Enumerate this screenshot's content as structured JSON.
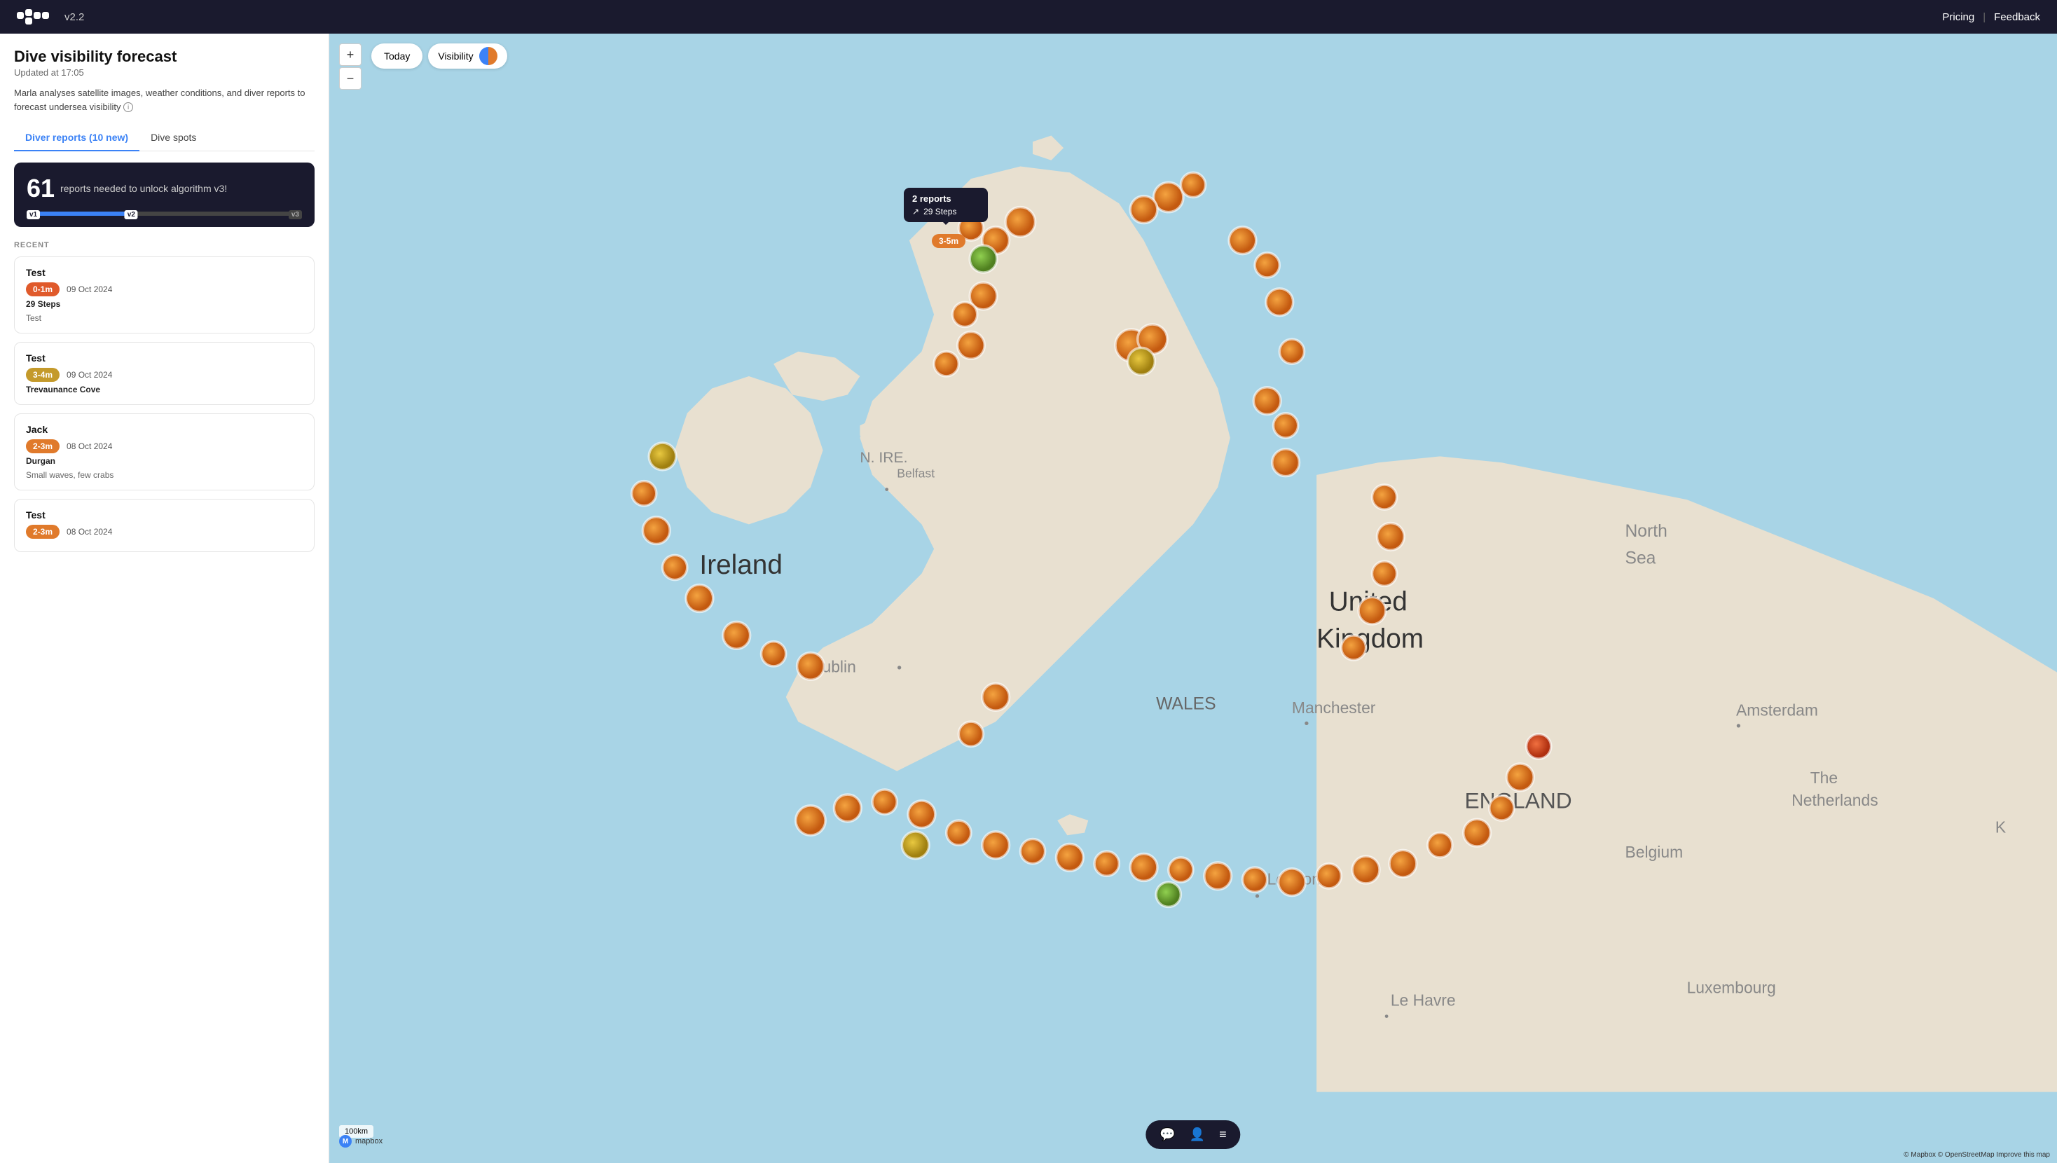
{
  "app": {
    "version": "v2.2",
    "nav": {
      "pricing": "Pricing",
      "separator": "|",
      "feedback": "Feedback"
    }
  },
  "sidebar": {
    "title": "Dive visibility forecast",
    "updated": "Updated at 17:05",
    "description": "Marla analyses satellite images, weather conditions, and diver reports to forecast undersea visibility",
    "tabs": [
      {
        "id": "reports",
        "label": "Diver reports (10 new)",
        "active": true
      },
      {
        "id": "spots",
        "label": "Dive spots",
        "active": false
      }
    ],
    "counter": {
      "number": "61",
      "text": "reports needed to unlock algorithm v3!",
      "v1_label": "v1",
      "v2_label": "v2",
      "v3_label": "v3"
    },
    "recent_label": "RECENT",
    "reports": [
      {
        "id": 1,
        "user": "Test",
        "visibility": "0-1m",
        "badge_class": "badge-red",
        "date": "09 Oct 2024",
        "location": "29 Steps",
        "note": "Test"
      },
      {
        "id": 2,
        "user": "Test",
        "visibility": "3-4m",
        "badge_class": "badge-yellow",
        "date": "09 Oct 2024",
        "location": "Trevaunance Cove",
        "note": ""
      },
      {
        "id": 3,
        "user": "Jack",
        "visibility": "2-3m",
        "badge_class": "badge-orange",
        "date": "08 Oct 2024",
        "location": "Durgan",
        "note": "Small waves, few crabs"
      },
      {
        "id": 4,
        "user": "Test",
        "visibility": "2-3m",
        "badge_class": "badge-orange",
        "date": "08 Oct 2024",
        "location": "",
        "note": ""
      }
    ]
  },
  "map": {
    "today_label": "Today",
    "visibility_label": "Visibility",
    "zoom_in": "+",
    "zoom_out": "−",
    "tooltip": {
      "reports": "2 reports",
      "steps_icon": "↗",
      "steps": "29 Steps"
    },
    "vis_chip": "3-5m",
    "scale_label": "100km",
    "attribution": "© Mapbox © OpenStreetMap Improve this map",
    "mapbox_label": "mapbox"
  },
  "bottom_bar": {
    "chat_icon": "💬",
    "people_icon": "👤",
    "menu_icon": "≡"
  }
}
